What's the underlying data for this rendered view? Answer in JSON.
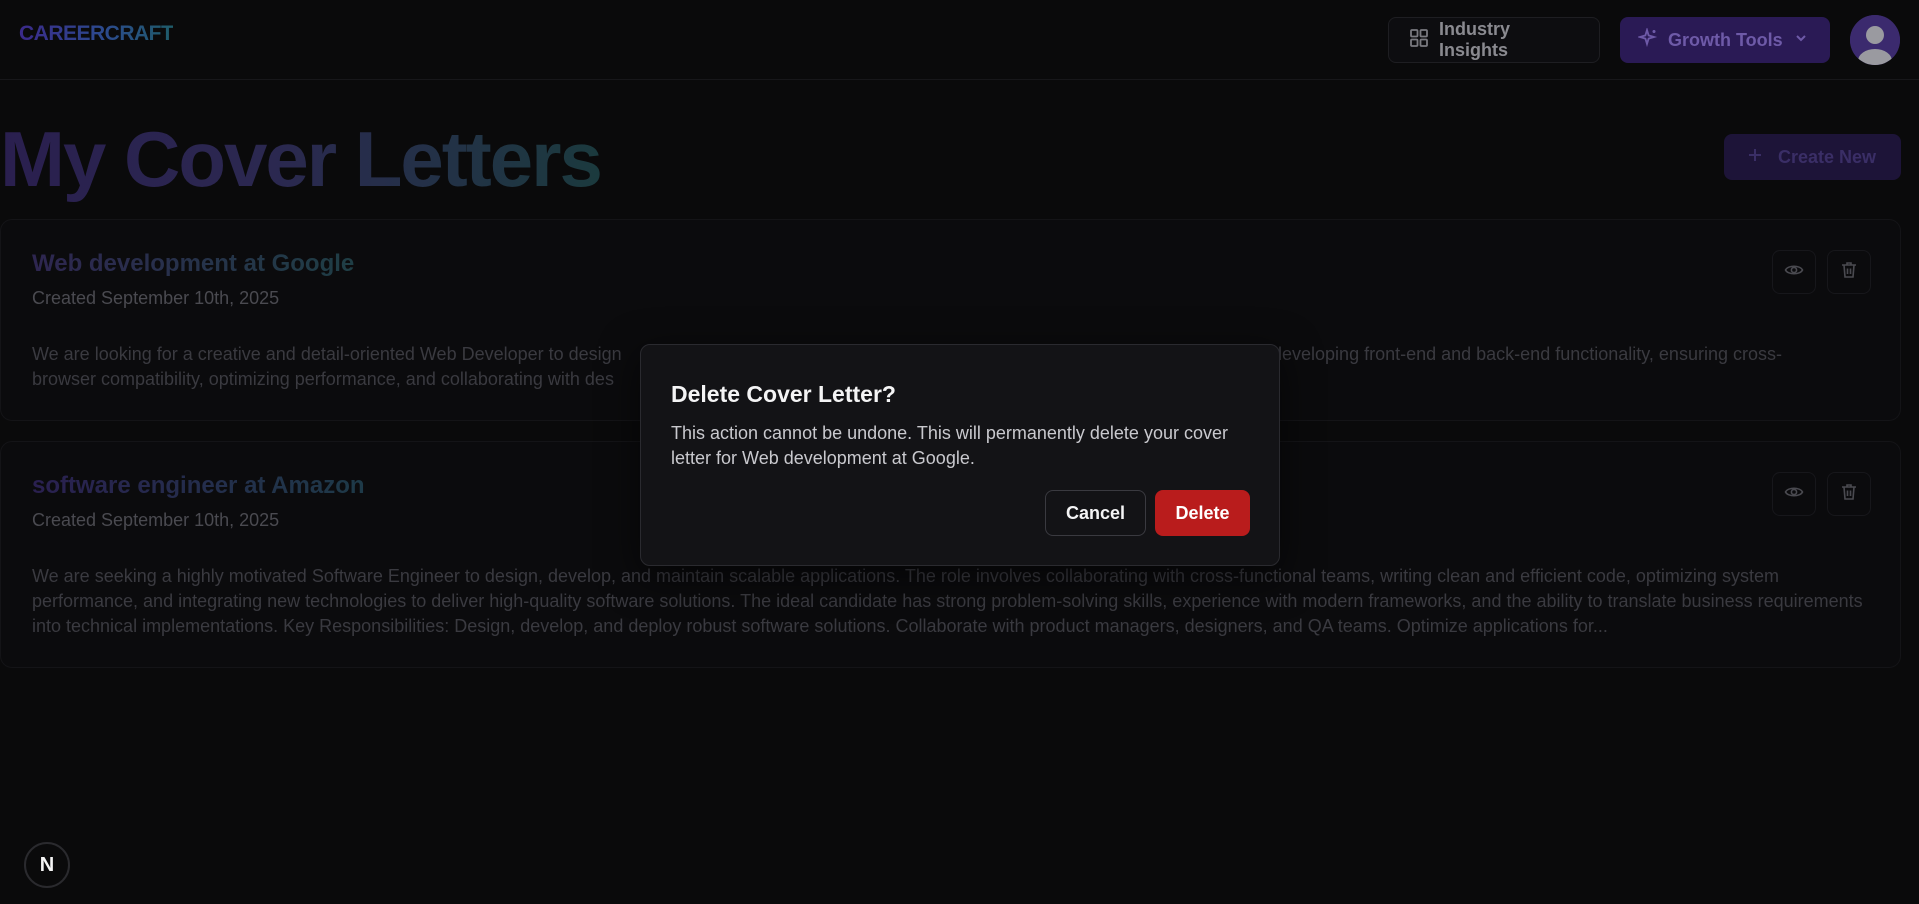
{
  "header": {
    "logo": "CAREERCRAFT",
    "industry_insights": "Industry Insights",
    "growth_tools": "Growth Tools"
  },
  "main": {
    "title": "My Cover Letters",
    "create_new": "Create New",
    "cards": [
      {
        "title": "Web development at Google",
        "date": "Created September 10th, 2025",
        "description_left": "We are looking for a creative and detail-oriented Web Developer to design",
        "description_right": "developing front-end and back-end functionality, ensuring cross-",
        "description_line2_left": "browser compatibility, optimizing performance, and collaborating with des"
      },
      {
        "title": "software engineer at Amazon",
        "date": "Created September 10th, 2025",
        "description": "We are seeking a highly motivated Software Engineer to design, develop, and maintain scalable applications. The role involves collaborating with cross-functional teams, writing clean and efficient code, optimizing system performance, and integrating new technologies to deliver high-quality software solutions. The ideal candidate has strong problem-solving skills, experience with modern frameworks, and the ability to translate business requirements into technical implementations. Key Responsibilities: Design, develop, and deploy robust software solutions. Collaborate with product managers, designers, and QA teams. Optimize applications for..."
      }
    ]
  },
  "modal": {
    "title": "Delete Cover Letter?",
    "description": "This action cannot be undone. This will permanently delete your cover letter for Web development at Google.",
    "cancel": "Cancel",
    "delete": "Delete"
  },
  "badge": "N",
  "colors": {
    "delete_red": "#b91c1c",
    "growth_purple": "#2a1a55"
  }
}
